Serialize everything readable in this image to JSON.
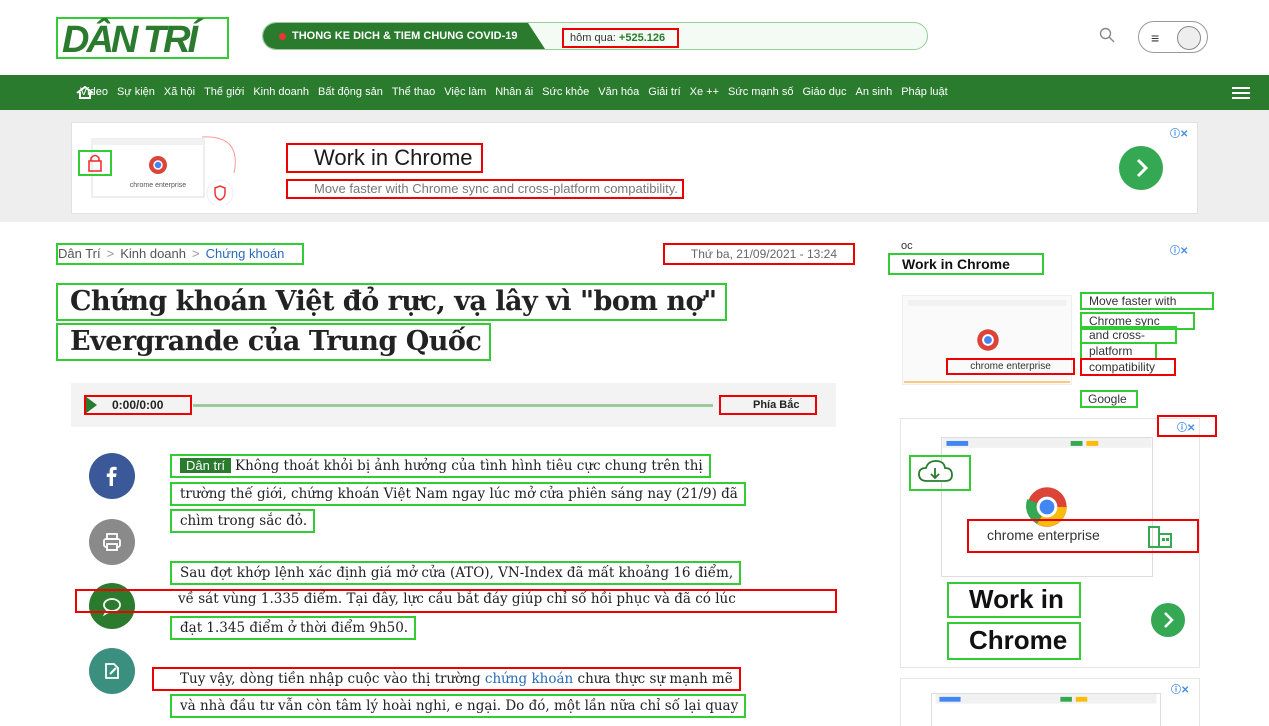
{
  "header": {
    "logo_text": "DÂN TRÍ",
    "covid_label": "THONG KE DICH & TIEM CHUNG COVID-19",
    "covid_stat_prefix": "hôm qua: ",
    "covid_stat_value": "+525.126"
  },
  "nav": {
    "items": [
      "Video",
      "Sự kiện",
      "Xã hội",
      "Thế giới",
      "Kinh doanh",
      "Bất động sản",
      "Thể thao",
      "Việc làm",
      "Nhân ái",
      "Sức khỏe",
      "Văn hóa",
      "Giải trí",
      "Xe ++",
      "Sức mạnh số",
      "Giáo dục",
      "An sinh",
      "Pháp luật"
    ]
  },
  "ad_top": {
    "title": "Work in Chrome",
    "description": "Move faster with Chrome sync and cross-platform compatibility.",
    "thumb_caption": "chrome enterprise"
  },
  "breadcrumb": {
    "items": [
      "Dân Trí",
      "Kinh doanh",
      "Chứng khoán"
    ]
  },
  "article": {
    "date": "Thứ ba, 21/09/2021 - 13:24",
    "headline_lines": [
      "Chứng khoán Việt đỏ rực, vạ lây vì \"bom nợ\"",
      "Evergrande của Trung Quốc"
    ],
    "audio_time": "0:00/0:00",
    "audio_region": "Phía Bắc",
    "brand_tag": "Dân trí",
    "paragraphs": [
      "Không thoát khỏi bị ảnh hưởng của tình hình tiêu cực chung trên thị",
      "trường thế giới, chứng khoán Việt Nam ngay lúc mở cửa phiên sáng nay (21/9) đã",
      "chìm trong sắc đỏ.",
      "Sau đợt khớp lệnh xác định giá mở cửa (ATO), VN-Index đã mất khoảng 16 điểm,",
      "về sát vùng 1.335 điểm. Tại đây, lực cầu bắt đáy giúp chỉ số hồi phục và đã có lúc",
      "đạt 1.345 điểm ở thời điểm 9h50.",
      "Tuy vậy, dòng tiền nhập cuộc vào thị trường ",
      "chứng khoán",
      " chưa thực sự mạnh mẽ",
      "và nhà đầu tư vẫn còn tâm lý hoài nghi, e ngại. Do đó, một lần nữa chỉ số lại quay"
    ]
  },
  "sidebar": {
    "ad1": {
      "label": "oc",
      "title": "Work in Chrome",
      "caption": "chrome enterprise",
      "desc_lines": [
        "Move faster with",
        "Chrome sync",
        "and cross-",
        "platform",
        "compatibility"
      ],
      "sponsor": "Google"
    },
    "ad2": {
      "caption": "chrome enterprise",
      "title_line1": "Work in",
      "title_line2": "Chrome"
    }
  },
  "colors": {
    "brand_green": "#2a7b2e",
    "cta_green": "#34a853",
    "link_blue": "#2a6ab8"
  }
}
